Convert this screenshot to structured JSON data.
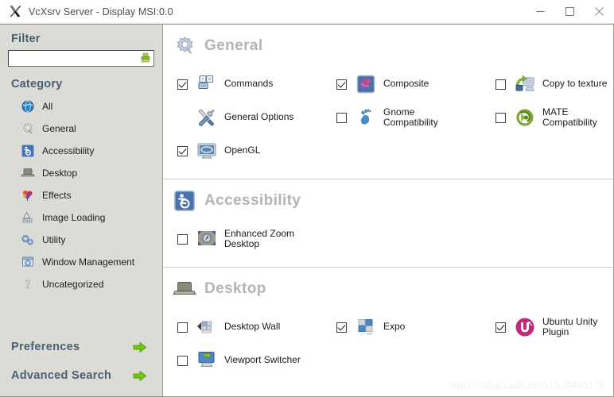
{
  "window": {
    "title": "VcXsrv Server - Display MSI:0.0",
    "app_icon": "x-logo-icon",
    "controls": {
      "minimize": "minimize-icon",
      "maximize": "maximize-icon",
      "close": "close-icon"
    }
  },
  "sidebar": {
    "filter_heading": "Filter",
    "filter_value": "",
    "filter_placeholder": "",
    "filter_icon": "clear-filter-icon",
    "category_heading": "Category",
    "categories": [
      {
        "label": "All",
        "icon": "globe-icon"
      },
      {
        "label": "General",
        "icon": "gear-icon"
      },
      {
        "label": "Accessibility",
        "icon": "accessibility-icon"
      },
      {
        "label": "Desktop",
        "icon": "desktop-icon"
      },
      {
        "label": "Effects",
        "icon": "effects-icon"
      },
      {
        "label": "Image Loading",
        "icon": "image-loading-icon"
      },
      {
        "label": "Utility",
        "icon": "utility-gears-icon"
      },
      {
        "label": "Window Management",
        "icon": "window-management-icon"
      },
      {
        "label": "Uncategorized",
        "icon": "question-mark-icon"
      }
    ],
    "footer_links": [
      {
        "label": "Preferences",
        "icon": "green-arrow-icon"
      },
      {
        "label": "Advanced Search",
        "icon": "green-arrow-icon"
      }
    ]
  },
  "main": {
    "sections": [
      {
        "title": "General",
        "icon": "gear-icon",
        "plugins": [
          {
            "label": "Commands",
            "icon": "keyboard-keys-icon",
            "checked": true,
            "has_checkbox": true
          },
          {
            "label": "Composite",
            "icon": "composite-icon",
            "checked": true,
            "has_checkbox": true
          },
          {
            "label": "Copy to texture",
            "icon": "copy-to-texture-icon",
            "checked": false,
            "has_checkbox": true
          },
          {
            "label": "General Options",
            "icon": "tools-icon",
            "checked": false,
            "has_checkbox": false
          },
          {
            "label": "Gnome Compatibility",
            "icon": "gnome-foot-icon",
            "checked": false,
            "has_checkbox": true
          },
          {
            "label": "MATE Compatibility",
            "icon": "mate-icon",
            "checked": false,
            "has_checkbox": true
          },
          {
            "label": "OpenGL",
            "icon": "opengl-monitor-icon",
            "checked": true,
            "has_checkbox": true
          }
        ]
      },
      {
        "title": "Accessibility",
        "icon": "accessibility-icon",
        "plugins": [
          {
            "label": "Enhanced Zoom Desktop",
            "icon": "enhanced-zoom-icon",
            "checked": false,
            "has_checkbox": true
          }
        ]
      },
      {
        "title": "Desktop",
        "icon": "desktop-icon",
        "plugins": [
          {
            "label": "Desktop Wall",
            "icon": "desktop-wall-icon",
            "checked": false,
            "has_checkbox": true
          },
          {
            "label": "Expo",
            "icon": "expo-icon",
            "checked": true,
            "has_checkbox": true
          },
          {
            "label": "Ubuntu Unity Plugin",
            "icon": "ubuntu-unity-icon",
            "checked": true,
            "has_checkbox": true
          },
          {
            "label": "Viewport Switcher",
            "icon": "viewport-switcher-icon",
            "checked": false,
            "has_checkbox": true
          }
        ]
      }
    ]
  },
  "watermark": "https://blog.csdn.net/l1528405176",
  "colors": {
    "sidebar_bg": "#dcdcd7",
    "heading_blue": "#4a5f72",
    "section_title_gray": "#b4b4b4",
    "arrow_green": "#67c614",
    "unity_magenta": "#bf2a7f"
  }
}
